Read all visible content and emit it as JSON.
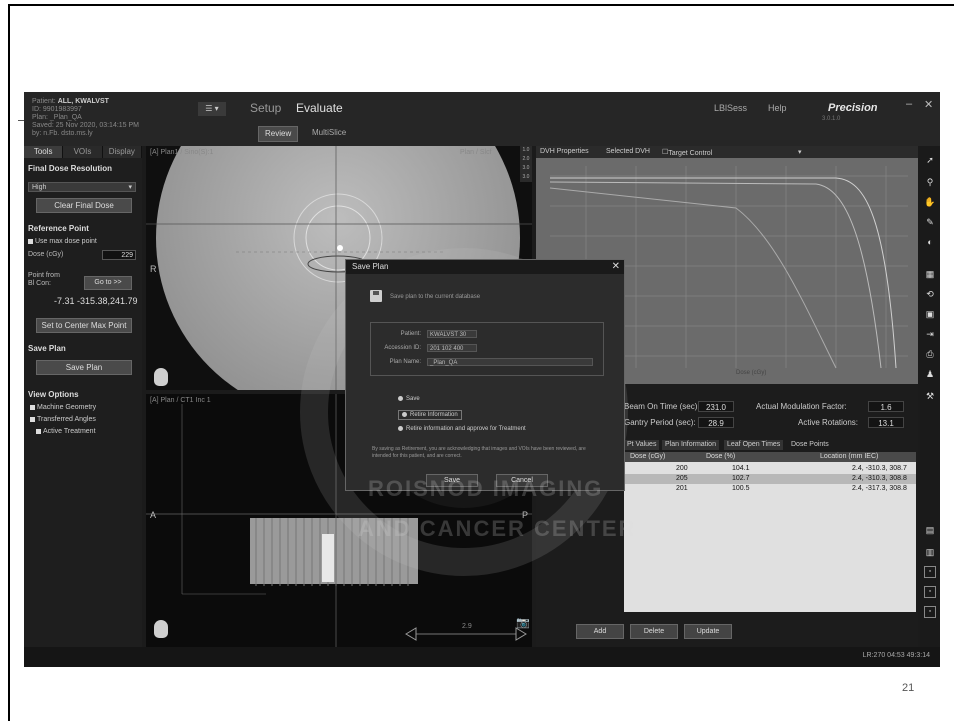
{
  "slide": {
    "page_number": "21"
  },
  "app": {
    "patient": {
      "name_label": "Patient:",
      "name": "ALL, KWALVST",
      "id": "ID: 9901983997",
      "plan": "Plan: _Plan_QA",
      "saved": "Saved: 25 Nov 2020, 03:14:15 PM",
      "by": "by: n.Fb. dsto.ms.ly"
    },
    "menu_label": "☰ ▾",
    "tabs": {
      "setup": "Setup",
      "evaluate": "Evaluate"
    },
    "subtabs": {
      "review": "Review",
      "multislice": "MultiSlice"
    },
    "top_right": {
      "user": "LBlSess",
      "help": "Help"
    },
    "brand": "Precision",
    "brand_version": "3.0.1.0",
    "window_buttons": {
      "minimize": "–",
      "close": "✕"
    }
  },
  "left_panel": {
    "tabs": [
      "Tools",
      "VOIs",
      "Display"
    ],
    "final_dose_resolution": "Final Dose Resolution",
    "resolution_value": "High",
    "clear_final_dose": "Clear Final Dose",
    "reference_point": "Reference Point",
    "use_max_dose": "Use max dose point",
    "dose_label": "Dose (cGy)",
    "dose_value": "229",
    "point_from_label": "Point from",
    "point_from_sub": "Bl Con:",
    "goto_label": "Go to >>",
    "coordinates": "-7.31 -315.38,241.79",
    "set_to_center": "Set to Center Max Point",
    "save_plan": "Save Plan",
    "save_plan_button": "Save Plan",
    "view_options": "View Options",
    "option1": "Machine Geometry",
    "option2": "Transferred Angles",
    "option3": "Active Treatment"
  },
  "views": {
    "top_label": "[A] Plan1 / Sino(S):1",
    "top_right_label": "Plan / Slcf",
    "bottom_label": "[A] Plan / CT1 Inc 1",
    "zoom": [
      "1.0",
      "2.0",
      "3.0",
      "3.0"
    ],
    "orient_r": "R",
    "orient_a": "A",
    "orient_p": "P",
    "scale": "2.9"
  },
  "right_panel": {
    "tabs": {
      "dvh": "DVH Properties",
      "selected": "Selected DVH",
      "target": "Target Control"
    },
    "axis_x": "Dose (cGy)",
    "stats": {
      "beam_on_label": "Beam On Time (sec):",
      "beam_on_value": "231.0",
      "gantry_label": "Gantry Period (sec):",
      "gantry_value": "28.9",
      "mod_factor_label": "Actual Modulation Factor:",
      "mod_factor_value": "1.6",
      "rotations_label": "Active Rotations:",
      "rotations_value": "13.1"
    },
    "subtabs": [
      "Pt Values",
      "Plan Information",
      "Leaf Open Times",
      "Dose Points"
    ],
    "table_headers": [
      "Dose (cGy)",
      "Dose (%)",
      "Location (mm IEC)"
    ],
    "rows": [
      [
        "200",
        "104.1",
        "2.4, -310.3, 308.7"
      ],
      [
        "205",
        "102.7",
        "2.4, -310.3, 308.8"
      ],
      [
        "201",
        "100.5",
        "2.4, -317.3, 308.8"
      ]
    ],
    "buttons": {
      "add": "Add",
      "delete": "Delete",
      "update": "Update"
    }
  },
  "status": {
    "text": "LR:270 04:53 49:3:14"
  },
  "dialog": {
    "title": "Save Plan",
    "message": "Save plan to the current database",
    "labels": {
      "patient": "Patient:",
      "accession": "Accession ID:",
      "plan_name": "Plan Name:"
    },
    "values": {
      "patient": "KWALVST 30",
      "accession": "201 102 400",
      "plan_name": "_Plan_QA"
    },
    "radio1": "Save",
    "radio2": "Retire Information",
    "radio3": "Retire information and approve for Treatment",
    "note": "By saving as Retirement, you are acknowledging that images and VOIs have been reviewed, are intended for this patient, and are correct.",
    "save_btn": "Save",
    "cancel_btn": "Cancel"
  },
  "watermark": {
    "line1": "ROISNOD IMAGING",
    "line2": "AND CANCER CENTER"
  }
}
